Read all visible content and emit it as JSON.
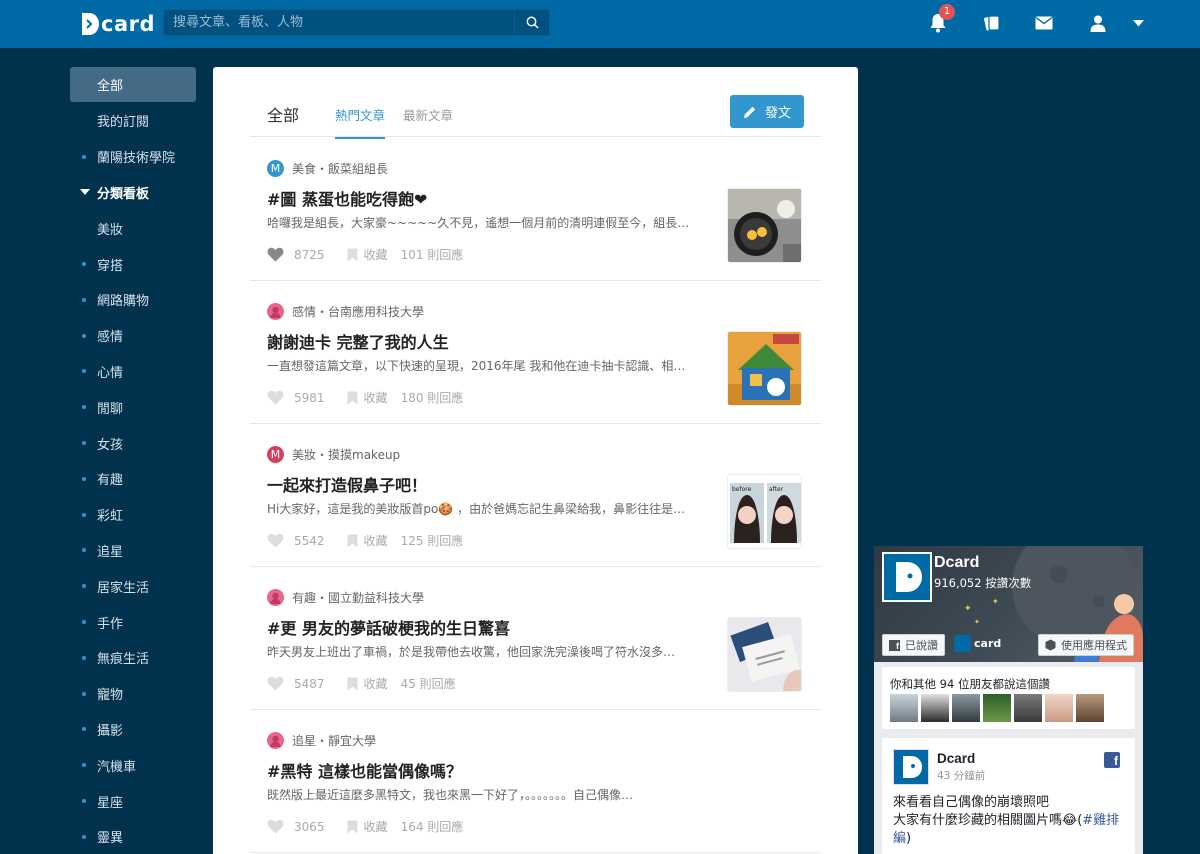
{
  "header": {
    "logo_text": "card",
    "search_placeholder": "搜尋文章、看板、人物",
    "notification_count": "1",
    "icons": [
      "bell-icon",
      "cards-icon",
      "mail-icon",
      "user-icon",
      "caret-down-icon"
    ],
    "brand_color": "#006aa6",
    "accent_color": "#3397cf"
  },
  "sidebar": {
    "items": [
      {
        "label": "全部",
        "kind": "active"
      },
      {
        "label": "我的訂閱",
        "kind": "plain"
      },
      {
        "label": "蘭陽技術學院",
        "kind": "dot"
      },
      {
        "label": "分類看板",
        "kind": "section"
      },
      {
        "label": "美妝",
        "kind": "plain"
      },
      {
        "label": "穿搭",
        "kind": "dot"
      },
      {
        "label": "網路購物",
        "kind": "dot"
      },
      {
        "label": "感情",
        "kind": "dot"
      },
      {
        "label": "心情",
        "kind": "dot"
      },
      {
        "label": "閒聊",
        "kind": "dot"
      },
      {
        "label": "女孩",
        "kind": "dot"
      },
      {
        "label": "有趣",
        "kind": "dot"
      },
      {
        "label": "彩虹",
        "kind": "dot"
      },
      {
        "label": "追星",
        "kind": "dot"
      },
      {
        "label": "居家生活",
        "kind": "dot"
      },
      {
        "label": "手作",
        "kind": "dot"
      },
      {
        "label": "無痕生活",
        "kind": "dot"
      },
      {
        "label": "寵物",
        "kind": "dot"
      },
      {
        "label": "攝影",
        "kind": "dot"
      },
      {
        "label": "汽機車",
        "kind": "dot"
      },
      {
        "label": "星座",
        "kind": "dot"
      },
      {
        "label": "靈異",
        "kind": "dot"
      }
    ]
  },
  "main": {
    "tab_all": "全部",
    "tab_hot": "熱門文章",
    "tab_new": "最新文章",
    "post_button": "發文"
  },
  "posts": [
    {
      "icon_letter": "M",
      "icon_color": "#3397cf",
      "meta": "美食・飯菜組組長",
      "title": "#圖 蒸蛋也能吃得飽❤",
      "excerpt": "哈囉我是組長，大家豪~~~~~久不見，遙想一個月前的清明連假至今，組長…",
      "likes": "8725",
      "save": "收藏",
      "replies": "101 則回應",
      "liked": true,
      "thumb": "eggs"
    },
    {
      "icon_letter": "",
      "icon_color": "#e8668e",
      "meta": "感情・台南應用科技大學",
      "title": "謝謝迪卡 完整了我的人生",
      "excerpt": "一直想發這篇文章，以下快速的呈現，2016年尾 我和他在迪卡抽卡認識、相…",
      "likes": "5981",
      "save": "收藏",
      "replies": "180 則回應",
      "liked": false,
      "thumb": "house"
    },
    {
      "icon_letter": "M",
      "icon_color": "#d43f5e",
      "meta": "美妝・摸摸makeup",
      "title": "一起來打造假鼻子吧！",
      "excerpt": "Hi大家好，這是我的美妝版首po🍪 ，由於爸媽忘記生鼻梁給我，鼻影往往是…",
      "likes": "5542",
      "save": "收藏",
      "replies": "125 則回應",
      "liked": false,
      "thumb": "beforeafter"
    },
    {
      "icon_letter": "",
      "icon_color": "#e8668e",
      "meta": "有趣・國立勤益科技大學",
      "title": "#更 男友的夢話破梗我的生日驚喜",
      "excerpt": "昨天男友上班出了車禍，於是我帶他去收驚，他回家洗完澡後喝了符水沒多…",
      "likes": "5487",
      "save": "收藏",
      "replies": "45 則回應",
      "liked": false,
      "thumb": "cards"
    },
    {
      "icon_letter": "",
      "icon_color": "#e8668e",
      "meta": "追星・靜宜大學",
      "title": "#黑特 這樣也能當偶像嗎？",
      "excerpt": "既然版上最近這麼多黑特文，我也來黑一下好了，。。。。。。。自己偶像…",
      "likes": "3065",
      "save": "收藏",
      "replies": "164 則回應",
      "liked": false,
      "thumb": ""
    }
  ],
  "facebook": {
    "page_name": "Dcard",
    "like_count": "916,052 按讚次數",
    "liked_button": "已說讚",
    "use_app_button": "使用應用程式",
    "friends_text": "你和其他 94 位朋友都說這個讚",
    "post_author": "Dcard",
    "post_time": "43 分鐘前",
    "post_line1": "來看看自己偶像的崩壞照吧",
    "post_line2": "大家有什麼珍藏的相關圖片嗎😂(",
    "post_tag": "#雞排編",
    "post_end": ")",
    "cover_brand": "card"
  }
}
